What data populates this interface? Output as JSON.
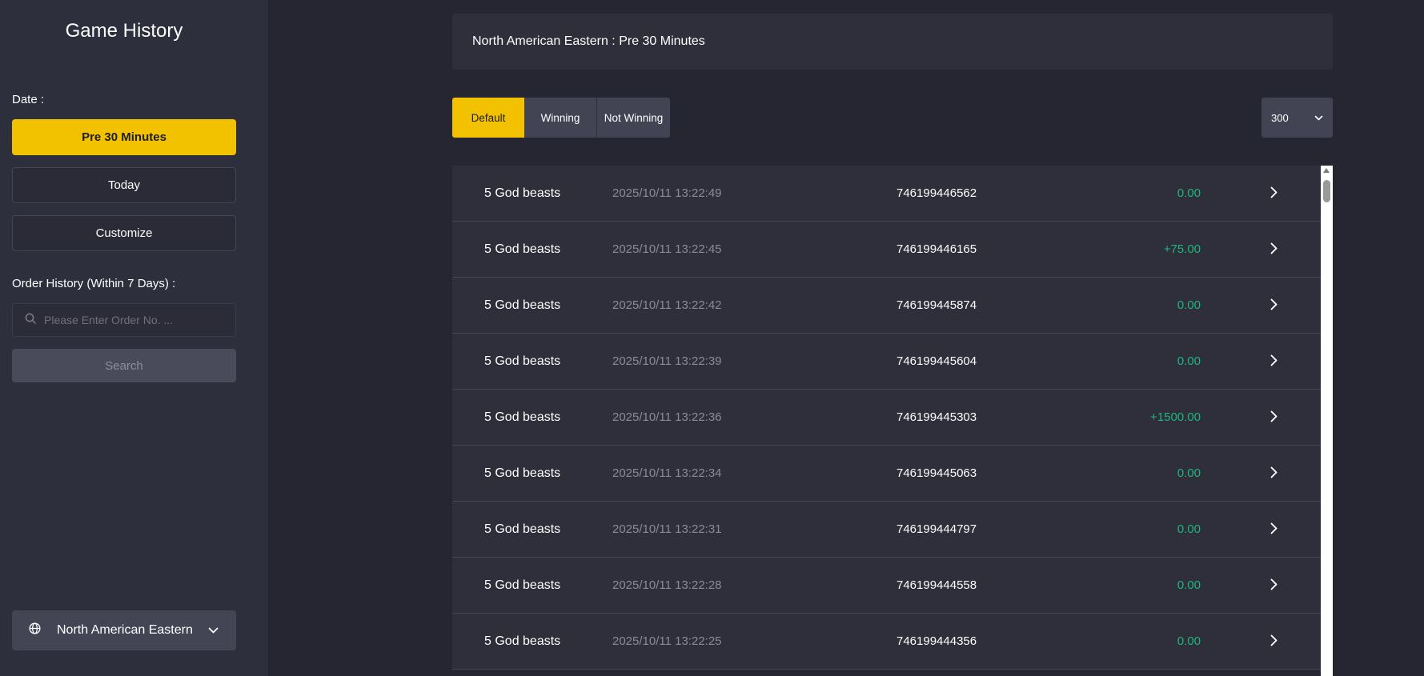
{
  "sidebar": {
    "title": "Game History",
    "date_label": "Date :",
    "date_options": [
      "Pre 30 Minutes",
      "Today",
      "Customize"
    ],
    "selected_date_option": "Pre 30 Minutes",
    "order_history_label": "Order History (Within 7 Days) :",
    "order_search": {
      "placeholder": "Please Enter Order No. ...",
      "value": ""
    },
    "search_button": "Search",
    "timezone": {
      "label": "North American Eastern",
      "icon": "globe-icon"
    }
  },
  "banner": {
    "text": "North American Eastern : Pre 30 Minutes"
  },
  "filters": {
    "tabs": [
      "Default",
      "Winning",
      "Not Winning"
    ],
    "active": "Default",
    "page_size": "300"
  },
  "records": [
    {
      "game": "5 God beasts",
      "time": "2025/10/11 13:22:49",
      "order": "746199446562",
      "amount": "0.00"
    },
    {
      "game": "5 God beasts",
      "time": "2025/10/11 13:22:45",
      "order": "746199446165",
      "amount": "+75.00"
    },
    {
      "game": "5 God beasts",
      "time": "2025/10/11 13:22:42",
      "order": "746199445874",
      "amount": "0.00"
    },
    {
      "game": "5 God beasts",
      "time": "2025/10/11 13:22:39",
      "order": "746199445604",
      "amount": "0.00"
    },
    {
      "game": "5 God beasts",
      "time": "2025/10/11 13:22:36",
      "order": "746199445303",
      "amount": "+1500.00"
    },
    {
      "game": "5 God beasts",
      "time": "2025/10/11 13:22:34",
      "order": "746199445063",
      "amount": "0.00"
    },
    {
      "game": "5 God beasts",
      "time": "2025/10/11 13:22:31",
      "order": "746199444797",
      "amount": "0.00"
    },
    {
      "game": "5 God beasts",
      "time": "2025/10/11 13:22:28",
      "order": "746199444558",
      "amount": "0.00"
    },
    {
      "game": "5 God beasts",
      "time": "2025/10/11 13:22:25",
      "order": "746199444356",
      "amount": "0.00"
    }
  ],
  "colors": {
    "accent": "#f2c200",
    "win_amount": "#1fb57e",
    "background": "#252631",
    "panel": "#2e2f3b"
  }
}
